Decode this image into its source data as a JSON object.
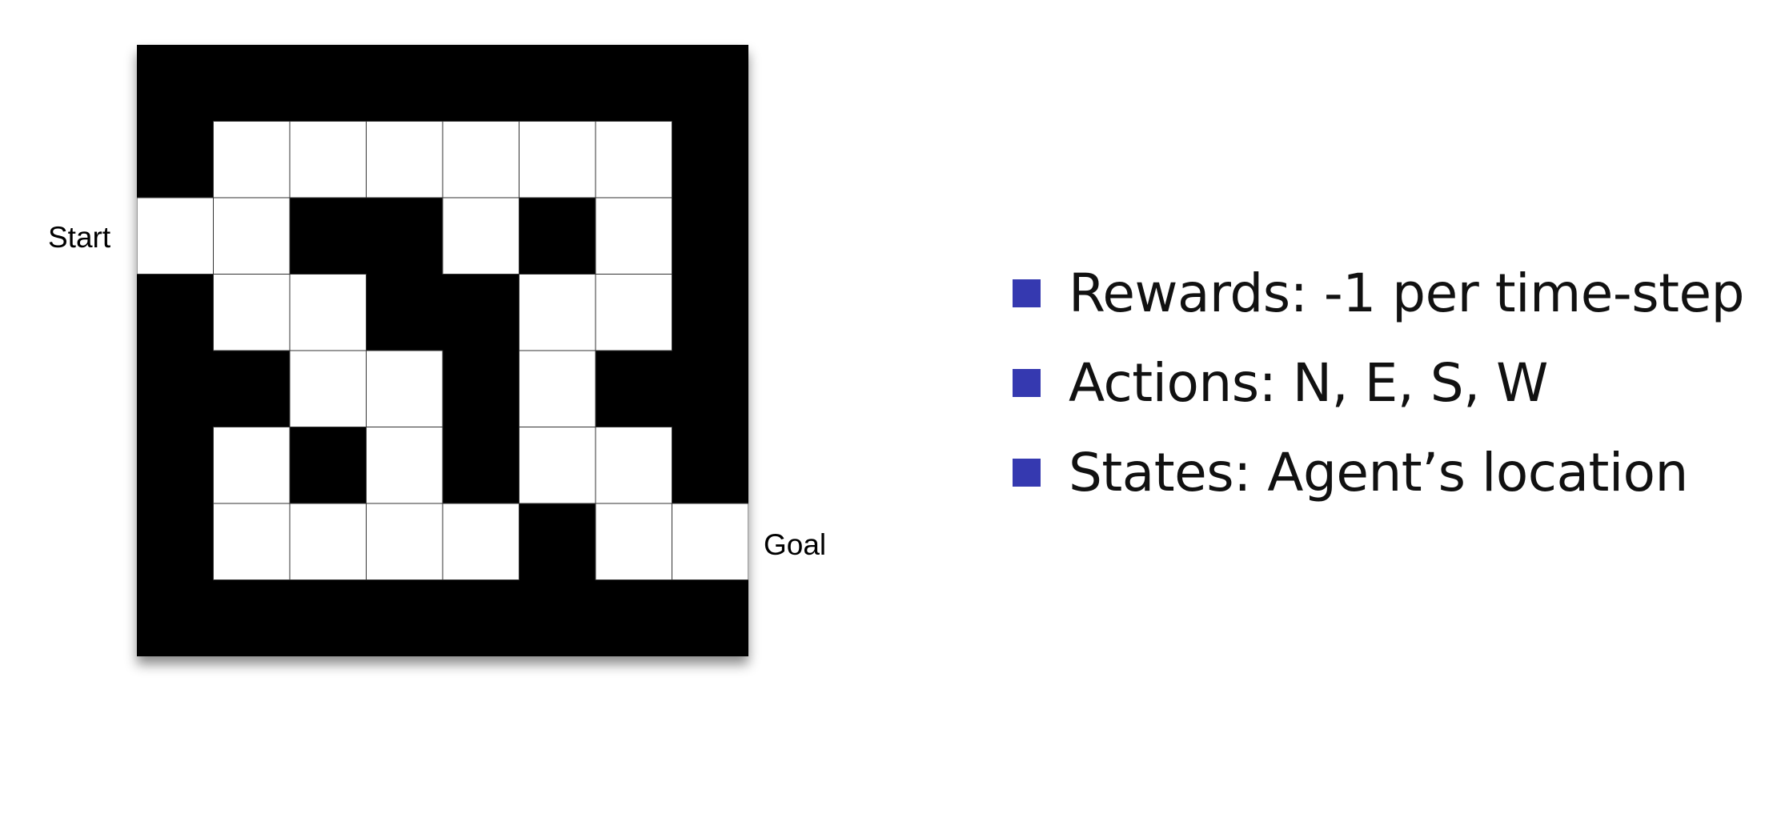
{
  "maze": {
    "start_label": "Start",
    "goal_label": "Goal",
    "wall_color": "#000000",
    "cell_color": "#ffffff",
    "grid_line_color": "#333333",
    "rows": [
      "########",
      "#......#",
      "..##.#.#",
      "#..##..#",
      "##..#.##",
      "#.#.#..#",
      "#....#..",
      "########"
    ]
  },
  "bullets": {
    "marker_color": "#3539b0",
    "items": [
      "Rewards: -1 per time-step",
      "Actions: N, E, S, W",
      "States: Agent’s location"
    ]
  }
}
